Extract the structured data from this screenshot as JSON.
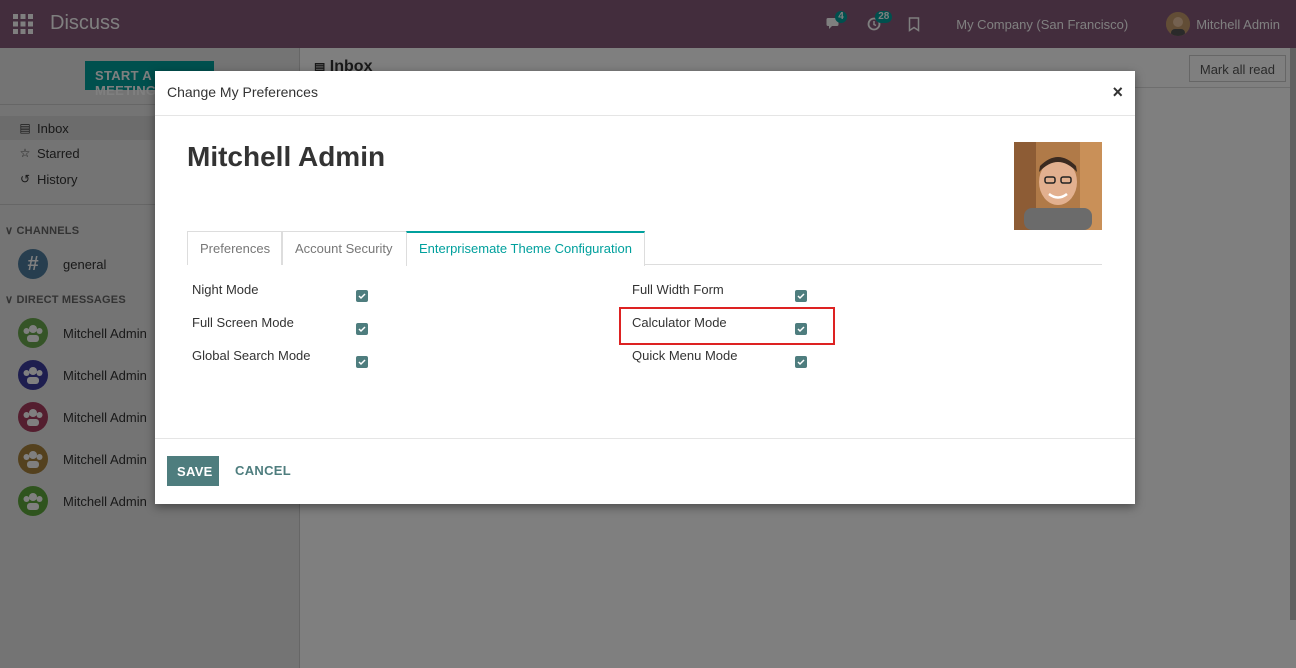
{
  "navbar": {
    "app_title": "Discuss",
    "messages_badge": "4",
    "activities_badge": "28",
    "company": "My Company (San Francisco)",
    "user_name": "Mitchell Admin",
    "bg_color": "#875a7b"
  },
  "sidebar": {
    "start_button": "START A MEETING",
    "mailboxes": [
      {
        "label": "Inbox",
        "icon": "inbox-icon"
      },
      {
        "label": "Starred",
        "icon": "star-icon"
      },
      {
        "label": "History",
        "icon": "history-icon"
      }
    ],
    "channels_header": "CHANNELS",
    "channels": [
      {
        "label": "general",
        "icon": "hashtag-icon"
      }
    ],
    "dm_header": "DIRECT MESSAGES",
    "direct_messages": [
      {
        "label": "Mitchell Admin",
        "color": "#6aa84f"
      },
      {
        "label": "Mitchell Admin",
        "color": "#3d3d9f"
      },
      {
        "label": "Mitchell Admin",
        "color": "#a83d5e"
      },
      {
        "label": "Mitchell Admin",
        "color": "#a8823d"
      },
      {
        "label": "Mitchell Admin",
        "color": "#5fa83d"
      }
    ]
  },
  "main": {
    "title": "Inbox",
    "mark_all_read": "Mark all read"
  },
  "modal": {
    "title": "Change My Preferences",
    "close": "×",
    "profile_name": "Mitchell Admin",
    "tabs": [
      {
        "label": "Preferences",
        "active": false
      },
      {
        "label": "Account Security",
        "active": false
      },
      {
        "label": "Enterprisemate Theme Configuration",
        "active": true
      }
    ],
    "options_left": [
      {
        "label": "Night Mode",
        "checked": true
      },
      {
        "label": "Full Screen Mode",
        "checked": true
      },
      {
        "label": "Global Search Mode",
        "checked": true
      }
    ],
    "options_right": [
      {
        "label": "Full Width Form",
        "checked": true
      },
      {
        "label": "Calculator Mode",
        "checked": true
      },
      {
        "label": "Quick Menu Mode",
        "checked": true
      }
    ],
    "save": "SAVE",
    "cancel": "CANCEL",
    "accent_color": "#00a09d",
    "button_color": "#4e7d7e"
  }
}
